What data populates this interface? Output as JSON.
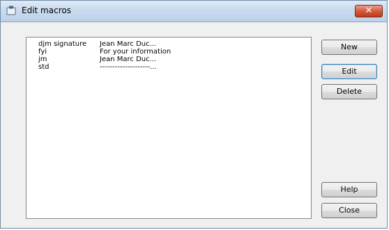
{
  "window": {
    "title": "Edit macros",
    "close_label": "✕",
    "app_icon": "macro-app-icon"
  },
  "macros": [
    {
      "name": "djm signature",
      "text": "Jean Marc Duc..."
    },
    {
      "name": "fyi",
      "text": "For your information"
    },
    {
      "name": "jm",
      "text": "Jean Marc Duc..."
    },
    {
      "name": "std",
      "text": "--------------------..."
    }
  ],
  "buttons": {
    "new": "New",
    "edit": "Edit",
    "delete": "Delete",
    "help": "Help",
    "close": "Close"
  }
}
